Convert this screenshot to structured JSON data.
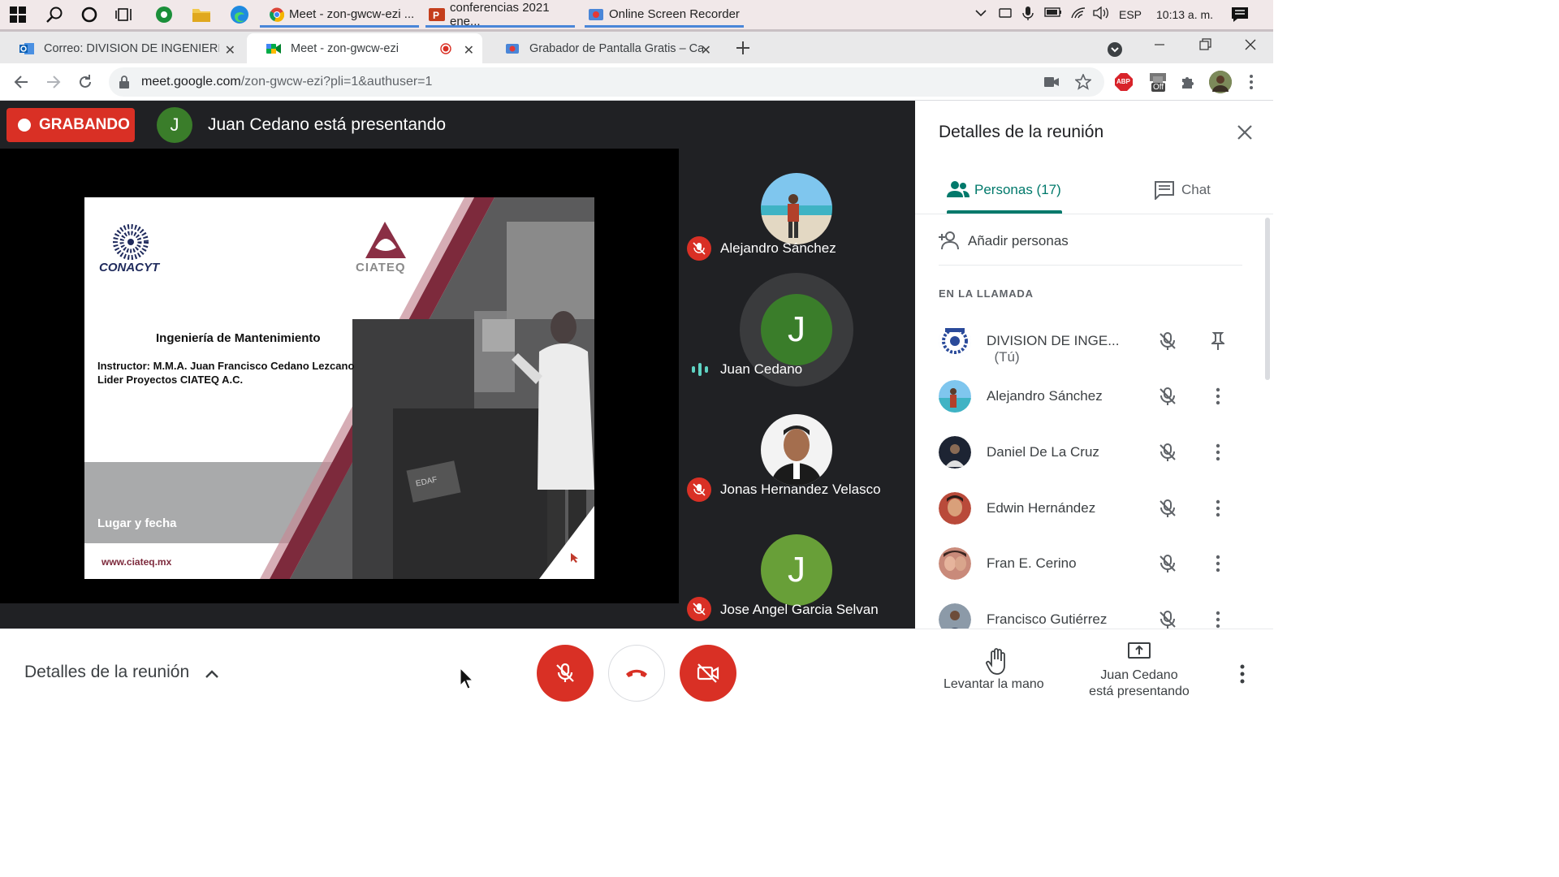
{
  "taskbar": {
    "apps": [
      {
        "label": "Meet - zon-gwcw-ezi ...",
        "icon": "chrome-icon"
      },
      {
        "label": "conferencias 2021 ene...",
        "icon": "powerpoint-icon"
      },
      {
        "label": "Online Screen Recorder",
        "icon": "recorder-icon"
      }
    ],
    "language": "ESP",
    "time": "10:13 a. m."
  },
  "browser": {
    "tabs": [
      {
        "title": "Correo: DIVISION DE INGENIERIA",
        "icon": "outlook-icon",
        "active": false
      },
      {
        "title": "Meet - zon-gwcw-ezi",
        "icon": "meet-icon",
        "active": true
      },
      {
        "title": "Grabador de Pantalla Gratis – Ca",
        "icon": "recorder-icon",
        "active": false
      }
    ],
    "url_host": "meet.google.com",
    "url_path": "/zon-gwcw-ezi?pli=1&authuser=1",
    "abp_label": "ABP",
    "off_label": "Off"
  },
  "meet": {
    "recording_label": "GRABANDO",
    "presenter_initial": "J",
    "presenter_text": "Juan Cedano está presentando",
    "slide": {
      "logo_left": "CONACYT",
      "logo_right": "CIATEQ",
      "title": "Ingeniería de Mantenimiento",
      "instructor_line1": "Instructor: M.M.A. Juan Francisco Cedano Lezcano",
      "instructor_line2": "Lider Proyectos CIATEQ A.C.",
      "place_date": "Lugar y fecha",
      "website": "www.ciateq.mx",
      "machine_label": "EDAF"
    },
    "tiles": [
      {
        "name": "Alejandro Sánchez",
        "status": "muted"
      },
      {
        "name": "Juan Cedano",
        "initial": "J",
        "status": "speaking"
      },
      {
        "name": "Jonas Hernandez Velasco",
        "status": "muted"
      },
      {
        "name": "Jose Angel Garcia Selvan",
        "initial": "J",
        "status": "muted"
      }
    ]
  },
  "panel": {
    "title": "Detalles de la reunión",
    "tab_people": "Personas (17)",
    "tab_chat": "Chat",
    "add_people": "Añadir personas",
    "section_label": "EN LA LLAMADA",
    "people": [
      {
        "name": "DIVISION DE INGE...",
        "suffix": "(Tú)",
        "action": "pin"
      },
      {
        "name": "Alejandro Sánchez",
        "action": "more"
      },
      {
        "name": "Daniel De La Cruz",
        "action": "more"
      },
      {
        "name": "Edwin Hernández",
        "action": "more"
      },
      {
        "name": "Fran E. Cerino",
        "action": "more"
      },
      {
        "name": "Francisco Gutiérrez",
        "action": "more"
      }
    ]
  },
  "bottom": {
    "details_label": "Detalles de la reunión",
    "raise_hand_label": "Levantar la mano",
    "presenting_line1": "Juan Cedano",
    "presenting_line2": "está presentando"
  },
  "colors": {
    "meet_red": "#d93025",
    "meet_green": "#1e8e3e",
    "avatar_green": "#3a7d2a",
    "stage_dark": "#202124",
    "accent_teal": "#00796b"
  }
}
